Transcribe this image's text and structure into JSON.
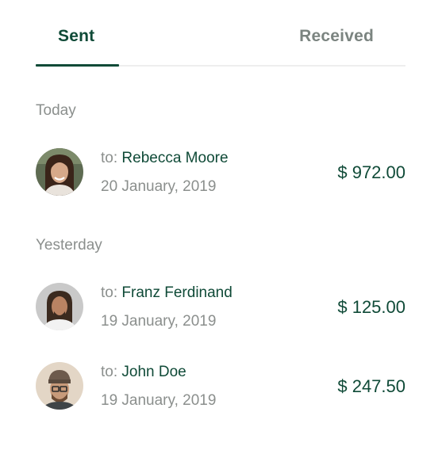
{
  "tabs": {
    "sent_label": "Sent",
    "received_label": "Received",
    "active": "sent"
  },
  "sections": [
    {
      "label": "Today",
      "transactions": [
        {
          "to_label": "to:",
          "name": "Rebecca Moore",
          "date": "20 January, 2019",
          "amount": "$ 972.00",
          "avatar": "woman-long-hair-avatar"
        }
      ]
    },
    {
      "label": "Yesterday",
      "transactions": [
        {
          "to_label": "to:",
          "name": "Franz Ferdinand",
          "date": "19 January, 2019",
          "amount": "$ 125.00",
          "avatar": "man-dreadlocks-avatar"
        },
        {
          "to_label": "to:",
          "name": "John Doe",
          "date": "19 January, 2019",
          "amount": "$ 247.50",
          "avatar": "man-beanie-glasses-avatar"
        }
      ]
    }
  ],
  "colors": {
    "primary": "#0f4a37",
    "muted": "#8b8f8d",
    "inactive_tab": "#7b8480",
    "divider": "#eeeeee"
  }
}
